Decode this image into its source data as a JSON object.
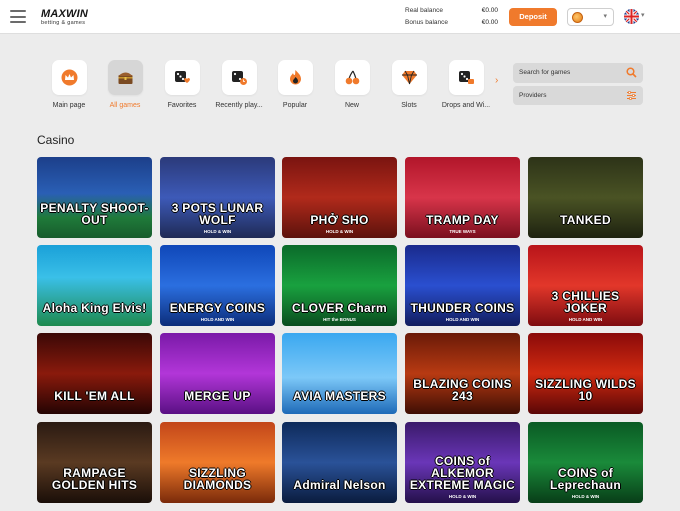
{
  "header": {
    "logo_line1": "MAXWIN",
    "logo_line2": "betting & games",
    "real_balance_label": "Real balance",
    "real_balance_value": "€0.00",
    "bonus_balance_label": "Bonus balance",
    "bonus_balance_value": "€0.00",
    "deposit_label": "Deposit",
    "colors": {
      "accent": "#f07a2c"
    }
  },
  "categories": [
    {
      "label": "Main page",
      "icon": "crown-icon"
    },
    {
      "label": "All games",
      "icon": "treasure-chest-icon",
      "active": true
    },
    {
      "label": "Favorites",
      "icon": "dice-heart-icon"
    },
    {
      "label": "Recently play...",
      "icon": "dice-clock-icon"
    },
    {
      "label": "Popular",
      "icon": "flame-icon"
    },
    {
      "label": "New",
      "icon": "cherries-icon"
    },
    {
      "label": "Slots",
      "icon": "diamond-icon"
    },
    {
      "label": "Drops and Wi...",
      "icon": "dice-tag-icon"
    }
  ],
  "search": {
    "placeholder": "Search for games"
  },
  "providers": {
    "label": "Providers"
  },
  "section": {
    "title": "Casino"
  },
  "games": [
    {
      "name": "PENALTY SHOOT-OUT",
      "sub": "",
      "bg": "linear-gradient(180deg,#1c3f8a 0%,#2a5fb5 45%,#1f7a3a 75%,#175c2c 100%)"
    },
    {
      "name": "3 POTS LUNAR WOLF",
      "sub": "HOLD & WIN",
      "bg": "linear-gradient(180deg,#2b3a7a 0%,#3d5ab8 50%,#1f2a55 100%)"
    },
    {
      "name": "PHỞ SHO",
      "sub": "HOLD & WIN",
      "bg": "linear-gradient(180deg,#7a1410 0%,#b12a1b 50%,#5c120c 100%)"
    },
    {
      "name": "TRAMP DAY",
      "sub": "TRUE WAYS",
      "bg": "linear-gradient(180deg,#b2162a 0%,#d8354a 50%,#7a0f1e 100%)"
    },
    {
      "name": "TANKED",
      "sub": "",
      "bg": "linear-gradient(180deg,#2d3318 0%,#4a5324 50%,#1e2210 100%)"
    },
    {
      "name": "Aloha King Elvis!",
      "sub": "",
      "bg": "linear-gradient(180deg,#1aa0d8 0%,#3ac0e8 40%,#1e8a4e 100%)"
    },
    {
      "name": "ENERGY COINS",
      "sub": "HOLD AND WIN",
      "bg": "linear-gradient(180deg,#0f47b8 0%,#2b6fe0 50%,#0c2d7a 100%)"
    },
    {
      "name": "CLOVER Charm",
      "sub": "HIT the BONUS",
      "bg": "linear-gradient(180deg,#0b6a2a 0%,#19a13f 50%,#0a4d1f 100%)"
    },
    {
      "name": "THUNDER COINS",
      "sub": "HOLD AND WIN",
      "bg": "linear-gradient(180deg,#1a2a8c 0%,#2a4fd0 50%,#121d5e 100%)"
    },
    {
      "name": "3 CHILLIES JOKER",
      "sub": "HOLD AND WIN",
      "bg": "linear-gradient(180deg,#b8141a 0%,#e2372a 50%,#7e0c10 100%)"
    },
    {
      "name": "KILL 'EM ALL",
      "sub": "",
      "bg": "linear-gradient(180deg,#3a0806 0%,#8a1a0c 50%,#240403 100%)"
    },
    {
      "name": "MERGE UP",
      "sub": "",
      "bg": "linear-gradient(180deg,#7a1aa8 0%,#b236d8 50%,#5a1084 100%)"
    },
    {
      "name": "AVIA MASTERS",
      "sub": "",
      "bg": "linear-gradient(180deg,#3aa8f0 0%,#7cc8f8 55%,#1e6ab8 100%)"
    },
    {
      "name": "BLAZING COINS 243",
      "sub": "",
      "bg": "linear-gradient(180deg,#6a1a08 0%,#b83a12 50%,#3e0e04 100%)"
    },
    {
      "name": "SIZZLING WILDS 10",
      "sub": "",
      "bg": "linear-gradient(180deg,#8a0a0a 0%,#d02a10 50%,#5a0606 100%)"
    },
    {
      "name": "RAMPAGE GOLDEN HITS",
      "sub": "",
      "bg": "linear-gradient(180deg,#2a1a12 0%,#5a3a22 50%,#1a0e08 100%)"
    },
    {
      "name": "SIZZLING DIAMONDS",
      "sub": "",
      "bg": "linear-gradient(180deg,#c2461a 0%,#ef7a2a 50%,#7a2a0a 100%)"
    },
    {
      "name": "Admiral Nelson",
      "sub": "",
      "bg": "linear-gradient(180deg,#0e2a5a 0%,#2a5298 50%,#0a1c3e 100%)"
    },
    {
      "name": "COINS of ALKEMOR EXTREME MAGIC",
      "sub": "HOLD & WIN",
      "bg": "linear-gradient(180deg,#3a1a6a 0%,#6a36b8 50%,#24104a 100%)"
    },
    {
      "name": "COINS of Leprechaun",
      "sub": "HOLD & WIN",
      "bg": "linear-gradient(180deg,#0a5a24 0%,#1a8a3a 50%,#083e18 100%)"
    }
  ]
}
